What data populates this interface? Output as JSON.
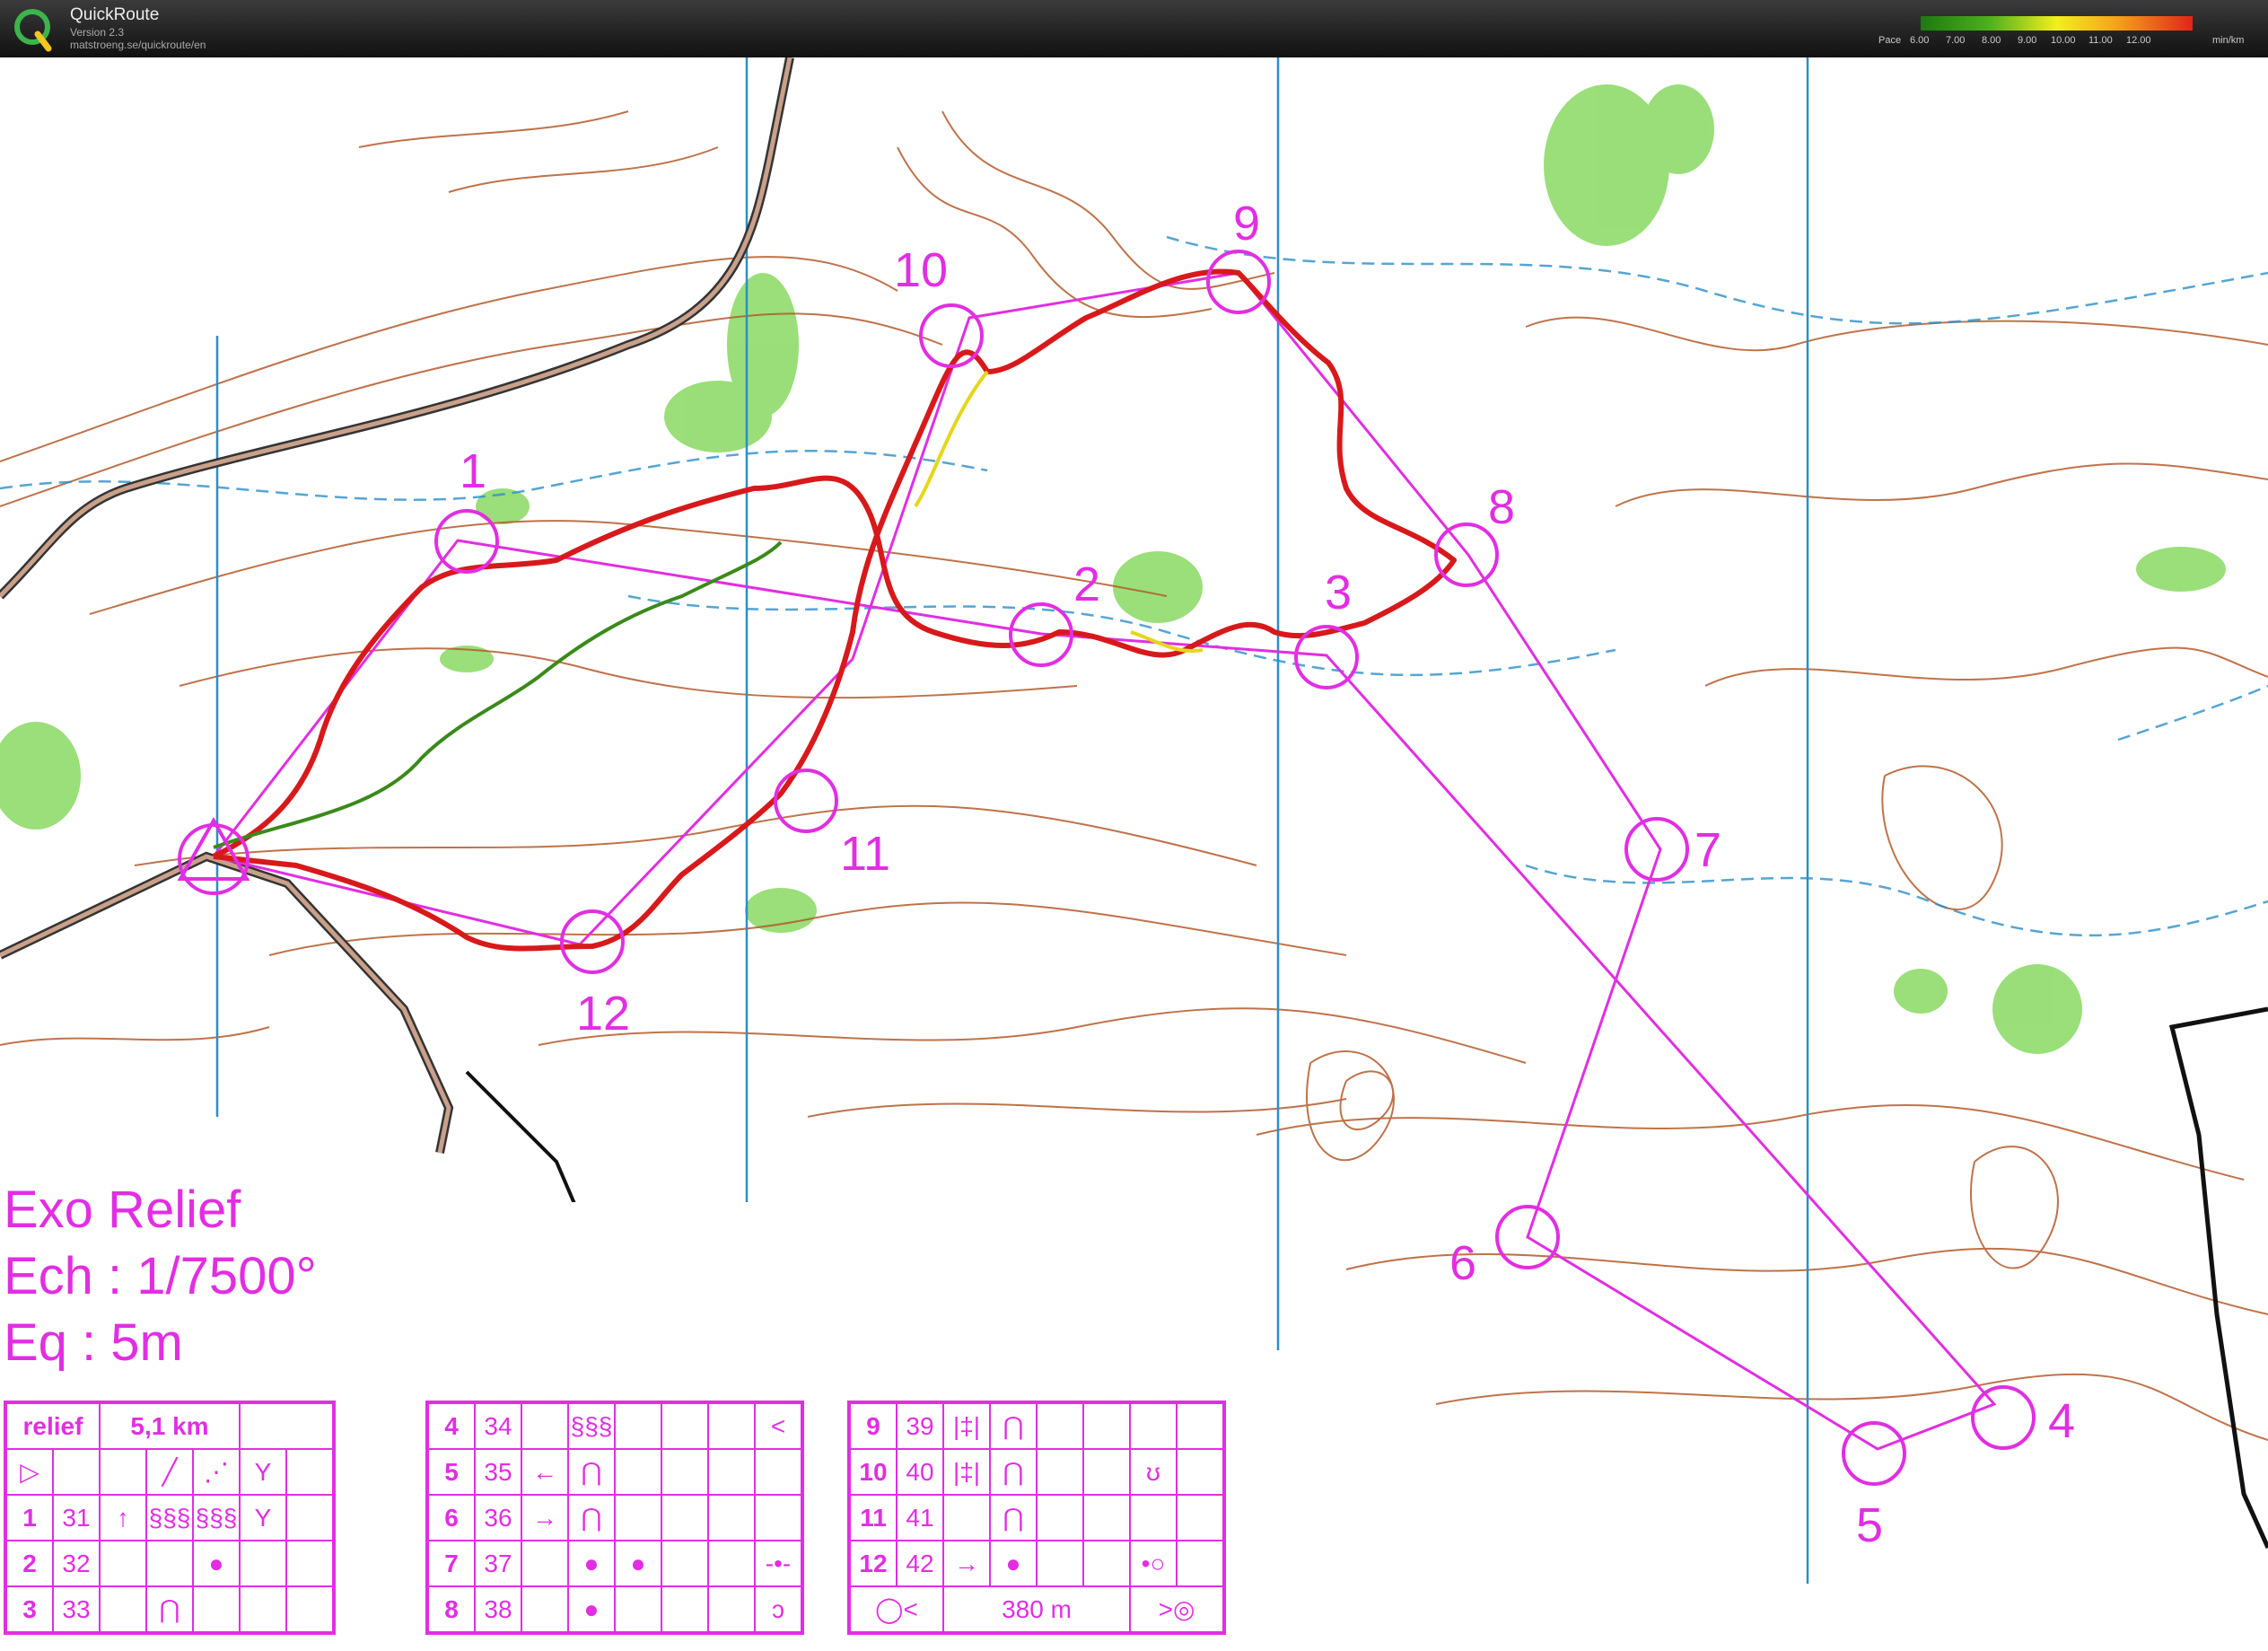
{
  "app": {
    "name": "QuickRoute",
    "version": "Version 2.3",
    "url": "matstroeng.se/quickroute/en"
  },
  "pace_legend": {
    "label": "Pace",
    "ticks": [
      "6.00",
      "7.00",
      "8.00",
      "9.00",
      "10.00",
      "11.00",
      "12.00"
    ],
    "unit": "min/km",
    "colors": [
      "#1d7a10",
      "#4caf1d",
      "#f2ef1d",
      "#f5a31a",
      "#e0251b"
    ]
  },
  "map": {
    "title_lines": [
      "Exo Relief",
      "Ech : 1/7500°",
      "Eq : 5m"
    ],
    "course_color": "#e22ee2",
    "contour_color": "#b55a2a",
    "water_color": "#2a8fc8",
    "vegetation_color": "#8fdb6a",
    "controls": [
      {
        "num": "1"
      },
      {
        "num": "2"
      },
      {
        "num": "3"
      },
      {
        "num": "4"
      },
      {
        "num": "5"
      },
      {
        "num": "6"
      },
      {
        "num": "7"
      },
      {
        "num": "8"
      },
      {
        "num": "9"
      },
      {
        "num": "10"
      },
      {
        "num": "11"
      },
      {
        "num": "12"
      }
    ]
  },
  "descriptions": {
    "header": {
      "course": "relief",
      "length": "5,1 km"
    },
    "rows_a": [
      {
        "num": "1",
        "code": "31",
        "c": "↑",
        "d": "§§§",
        "e": "§§§",
        "f": "Y"
      },
      {
        "num": "2",
        "code": "32",
        "c": "",
        "d": "",
        "e": "●",
        "f": ""
      },
      {
        "num": "3",
        "code": "33",
        "c": "",
        "d": "⋂",
        "e": "",
        "f": ""
      }
    ],
    "rows_b": [
      {
        "num": "4",
        "code": "34",
        "c": "",
        "d": "§§§",
        "e": "",
        "f": "<"
      },
      {
        "num": "5",
        "code": "35",
        "c": "←",
        "d": "⋂",
        "e": "",
        "f": ""
      },
      {
        "num": "6",
        "code": "36",
        "c": "→",
        "d": "⋂",
        "e": "",
        "f": ""
      },
      {
        "num": "7",
        "code": "37",
        "c": "",
        "d": "●",
        "e": "●",
        "f": "-•-"
      },
      {
        "num": "8",
        "code": "38",
        "c": "",
        "d": "●",
        "e": "",
        "f": "ᴐ"
      }
    ],
    "rows_c": [
      {
        "num": "9",
        "code": "39",
        "c": "|‡|",
        "d": "⋂",
        "e": "",
        "f": ""
      },
      {
        "num": "10",
        "code": "40",
        "c": "|‡|",
        "d": "⋂",
        "e": "",
        "f": "ʊ"
      },
      {
        "num": "11",
        "code": "41",
        "c": "",
        "d": "⋂",
        "e": "",
        "f": ""
      },
      {
        "num": "12",
        "code": "42",
        "c": "→",
        "d": "●",
        "e": "",
        "f": "•○"
      }
    ],
    "finish_distance": "380 m"
  }
}
